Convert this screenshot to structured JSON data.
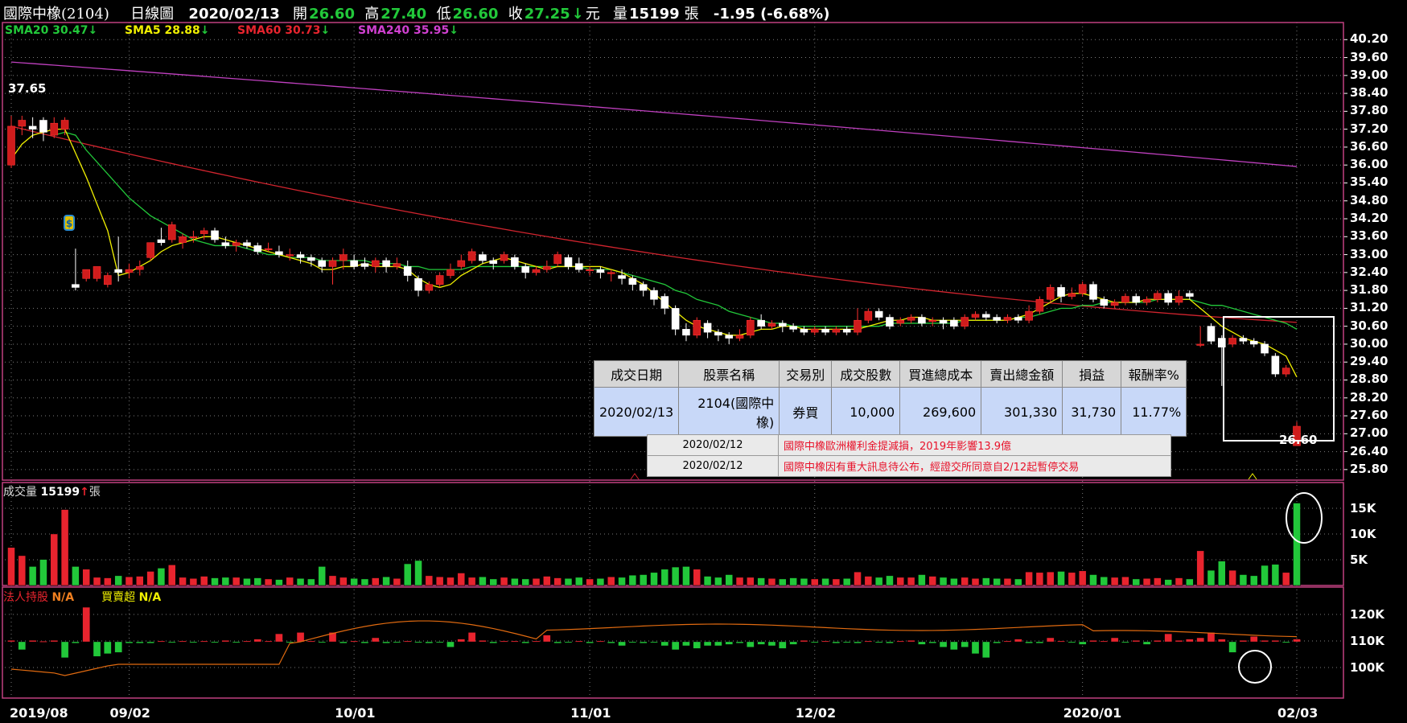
{
  "header": {
    "stock": "國際中橡(2104)",
    "period": "日線圖",
    "date": "2020/02/13",
    "open_label": "開",
    "open": "26.60",
    "high_label": "高",
    "high": "27.40",
    "low_label": "低",
    "low": "26.60",
    "close_label": "收",
    "close": "27.25",
    "currency": "元",
    "volume_label": "量",
    "volume": "15199",
    "volume_unit": "張",
    "change": "-1.95 (-6.68%)"
  },
  "sma": [
    {
      "label": "SMA20",
      "value": "30.47",
      "color": "#22c83a",
      "arrow": "down"
    },
    {
      "label": "SMA5",
      "value": "28.88",
      "color": "#f0f000",
      "arrow": "down"
    },
    {
      "label": "SMA60",
      "value": "30.73",
      "color": "#e8242e",
      "arrow": "down"
    },
    {
      "label": "SMA240",
      "value": "35.95",
      "color": "#d040d0",
      "arrow": "down"
    }
  ],
  "volume_panel": {
    "label": "成交量",
    "value": "15199",
    "unit": "張",
    "arrow": "up",
    "yticks": [
      "15K",
      "10K",
      "5K"
    ]
  },
  "inst_panel": {
    "label1": "法人持股",
    "value1": "N/A",
    "label2": "買賣超",
    "value2": "N/A",
    "yticks": [
      "120K",
      "110K",
      "100K"
    ]
  },
  "annotations": {
    "high_label": "37.65",
    "low_label": "26.60",
    "dividend_marker": "$"
  },
  "trade_table": {
    "headers": [
      "成交日期",
      "股票名稱",
      "交易別",
      "成交股數",
      "買進總成本",
      "賣出總金額",
      "損益",
      "報酬率%"
    ],
    "row": [
      "2020/02/13",
      "2104(國際中橡)",
      "券買",
      "10,000",
      "269,600",
      "301,330",
      "31,730",
      "11.77%"
    ]
  },
  "news": [
    {
      "date": "2020/02/12",
      "text": "國際中橡歐洲權利金提減損，2019年影響13.9億"
    },
    {
      "date": "2020/02/12",
      "text": "國際中橡因有重大訊息待公布，經證交所同意自2/12起暫停交易"
    }
  ],
  "chart_data": {
    "type": "candlestick",
    "title": "國際中橡(2104) 日線圖",
    "ylim": [
      25.5,
      40.45
    ],
    "price_ticks": [
      "40.20",
      "39.60",
      "39.00",
      "38.40",
      "37.80",
      "37.20",
      "36.60",
      "36.00",
      "35.40",
      "34.80",
      "34.20",
      "33.60",
      "33.00",
      "32.40",
      "31.80",
      "31.20",
      "30.60",
      "30.00",
      "29.40",
      "28.80",
      "28.20",
      "27.60",
      "27.00",
      "26.40",
      "25.80"
    ],
    "x_ticks": [
      "2019/08",
      "09/02",
      "10/01",
      "11/01",
      "12/02",
      "2020/01",
      "02/03"
    ],
    "candles": [
      [
        36.0,
        37.3,
        37.65,
        35.9,
        7000
      ],
      [
        37.3,
        37.5,
        37.65,
        37.0,
        5500
      ],
      [
        37.3,
        37.2,
        37.6,
        36.9,
        3500
      ],
      [
        37.5,
        37.1,
        37.6,
        36.8,
        4800
      ],
      [
        37.0,
        37.4,
        37.6,
        36.9,
        9500
      ],
      [
        37.2,
        37.5,
        37.6,
        37.0,
        14000
      ],
      [
        32.0,
        31.9,
        33.2,
        31.8,
        3500
      ],
      [
        32.2,
        32.5,
        32.5,
        32.1,
        3000
      ],
      [
        32.2,
        32.6,
        32.6,
        32.1,
        1500
      ],
      [
        32.0,
        32.3,
        32.4,
        31.9,
        1400
      ],
      [
        32.5,
        32.4,
        33.6,
        32.1,
        1800
      ],
      [
        32.4,
        32.5,
        32.7,
        32.2,
        1600
      ],
      [
        32.5,
        32.6,
        32.8,
        32.3,
        1700
      ],
      [
        32.9,
        33.4,
        33.4,
        32.8,
        2600
      ],
      [
        33.5,
        33.4,
        33.9,
        33.3,
        3200
      ],
      [
        33.5,
        34.0,
        34.1,
        33.4,
        3800
      ],
      [
        33.4,
        33.6,
        33.7,
        33.2,
        1500
      ],
      [
        33.6,
        33.6,
        33.8,
        33.4,
        1300
      ],
      [
        33.7,
        33.8,
        33.9,
        33.5,
        1700
      ],
      [
        33.8,
        33.5,
        33.9,
        33.4,
        1400
      ],
      [
        33.4,
        33.3,
        33.6,
        33.2,
        1500
      ],
      [
        33.3,
        33.4,
        33.5,
        33.1,
        1500
      ],
      [
        33.4,
        33.3,
        33.5,
        33.2,
        1300
      ],
      [
        33.3,
        33.1,
        33.4,
        33.0,
        1400
      ],
      [
        33.2,
        33.2,
        33.4,
        33.1,
        1200
      ],
      [
        33.1,
        33.0,
        33.3,
        32.9,
        1100
      ],
      [
        33.0,
        33.0,
        33.2,
        32.8,
        1500
      ],
      [
        33.0,
        32.9,
        33.1,
        32.7,
        1300
      ],
      [
        32.9,
        32.8,
        33.0,
        32.6,
        1200
      ],
      [
        32.8,
        32.6,
        32.9,
        32.4,
        3500
      ],
      [
        32.6,
        32.8,
        32.9,
        32.0,
        1800
      ],
      [
        32.8,
        33.0,
        33.2,
        32.5,
        1500
      ],
      [
        32.8,
        32.6,
        33.0,
        32.5,
        1300
      ],
      [
        32.7,
        32.6,
        32.9,
        32.5,
        1200
      ],
      [
        32.6,
        32.8,
        32.9,
        32.4,
        1400
      ],
      [
        32.8,
        32.6,
        32.9,
        32.4,
        1600
      ],
      [
        32.6,
        32.7,
        32.9,
        32.5,
        1300
      ],
      [
        32.6,
        32.3,
        32.8,
        32.1,
        4000
      ],
      [
        32.2,
        31.8,
        32.3,
        31.6,
        4600
      ],
      [
        31.8,
        32.0,
        32.1,
        31.7,
        1800
      ],
      [
        32.0,
        32.3,
        32.4,
        31.9,
        1600
      ],
      [
        32.3,
        32.5,
        32.7,
        32.2,
        1500
      ],
      [
        32.6,
        32.8,
        33.0,
        32.5,
        2300
      ],
      [
        32.8,
        33.1,
        33.2,
        32.7,
        1500
      ],
      [
        33.0,
        32.8,
        33.1,
        32.7,
        1600
      ],
      [
        32.8,
        32.7,
        32.9,
        32.5,
        1200
      ],
      [
        32.8,
        33.0,
        33.1,
        32.7,
        1500
      ],
      [
        32.9,
        32.6,
        33.0,
        32.5,
        1300
      ],
      [
        32.6,
        32.4,
        32.7,
        32.2,
        1200
      ],
      [
        32.4,
        32.5,
        32.6,
        32.3,
        1300
      ],
      [
        32.5,
        32.6,
        32.8,
        32.4,
        1700
      ],
      [
        32.7,
        33.0,
        33.1,
        32.6,
        1400
      ],
      [
        32.9,
        32.6,
        33.0,
        32.5,
        1300
      ],
      [
        32.7,
        32.5,
        32.9,
        32.4,
        1500
      ],
      [
        32.5,
        32.5,
        32.6,
        32.3,
        1200
      ],
      [
        32.5,
        32.4,
        32.6,
        32.2,
        1300
      ],
      [
        32.4,
        32.4,
        32.5,
        32.1,
        1600
      ],
      [
        32.3,
        32.2,
        32.5,
        32.0,
        1500
      ],
      [
        32.2,
        32.0,
        32.3,
        31.8,
        1900
      ],
      [
        32.0,
        31.8,
        32.1,
        31.6,
        2000
      ],
      [
        31.8,
        31.5,
        31.9,
        31.3,
        2400
      ],
      [
        31.6,
        31.2,
        31.7,
        31.0,
        3000
      ],
      [
        31.2,
        30.5,
        31.3,
        30.3,
        3400
      ],
      [
        30.5,
        30.3,
        30.7,
        30.1,
        3500
      ],
      [
        30.3,
        30.8,
        30.9,
        30.2,
        3000
      ],
      [
        30.7,
        30.4,
        30.8,
        30.2,
        1700
      ],
      [
        30.4,
        30.3,
        30.5,
        30.1,
        1500
      ],
      [
        30.3,
        30.2,
        30.4,
        30.0,
        2000
      ],
      [
        30.2,
        30.3,
        30.5,
        30.1,
        1500
      ],
      [
        30.3,
        30.8,
        30.9,
        30.2,
        1500
      ],
      [
        30.8,
        30.6,
        31.0,
        30.5,
        1400
      ],
      [
        30.6,
        30.7,
        30.8,
        30.5,
        1300
      ],
      [
        30.7,
        30.6,
        30.8,
        30.4,
        1200
      ],
      [
        30.6,
        30.5,
        30.7,
        30.4,
        1400
      ],
      [
        30.5,
        30.4,
        30.6,
        30.3,
        1300
      ],
      [
        30.4,
        30.5,
        30.6,
        30.3,
        1200
      ],
      [
        30.5,
        30.4,
        30.6,
        30.3,
        1300
      ],
      [
        30.4,
        30.5,
        30.6,
        30.3,
        1200
      ],
      [
        30.5,
        30.4,
        30.6,
        30.3,
        1300
      ],
      [
        30.4,
        30.8,
        31.2,
        30.3,
        2500
      ],
      [
        30.8,
        31.1,
        31.2,
        30.7,
        1700
      ],
      [
        31.1,
        30.9,
        31.2,
        30.8,
        1500
      ],
      [
        30.9,
        30.6,
        31.0,
        30.5,
        1800
      ],
      [
        30.7,
        30.8,
        30.9,
        30.6,
        1500
      ],
      [
        30.8,
        30.9,
        31.0,
        30.7,
        1500
      ],
      [
        30.9,
        30.7,
        31.0,
        30.6,
        2000
      ],
      [
        30.8,
        30.8,
        30.9,
        30.6,
        1700
      ],
      [
        30.8,
        30.7,
        30.9,
        30.5,
        1500
      ],
      [
        30.8,
        30.6,
        30.9,
        30.5,
        1300
      ],
      [
        30.6,
        30.9,
        31.0,
        30.5,
        1500
      ],
      [
        30.9,
        31.0,
        31.1,
        30.8,
        1300
      ],
      [
        31.0,
        30.9,
        31.1,
        30.8,
        1400
      ],
      [
        30.9,
        30.8,
        31.0,
        30.7,
        1300
      ],
      [
        30.8,
        30.9,
        31.0,
        30.7,
        1300
      ],
      [
        30.9,
        30.8,
        31.0,
        30.7,
        1200
      ],
      [
        30.8,
        31.1,
        31.3,
        30.7,
        2500
      ],
      [
        31.1,
        31.5,
        31.6,
        31.0,
        2400
      ],
      [
        31.5,
        31.9,
        32.0,
        31.4,
        2500
      ],
      [
        31.9,
        31.6,
        32.0,
        31.4,
        2600
      ],
      [
        31.6,
        31.7,
        31.9,
        31.5,
        2400
      ],
      [
        31.7,
        32.0,
        32.1,
        31.6,
        2700
      ],
      [
        32.0,
        31.5,
        32.1,
        31.4,
        2000
      ],
      [
        31.5,
        31.3,
        31.6,
        31.2,
        1600
      ],
      [
        31.3,
        31.4,
        31.5,
        31.2,
        1500
      ],
      [
        31.4,
        31.6,
        31.7,
        31.3,
        1600
      ],
      [
        31.6,
        31.4,
        31.7,
        31.3,
        1200
      ],
      [
        31.4,
        31.5,
        31.6,
        31.3,
        1300
      ],
      [
        31.5,
        31.7,
        31.8,
        31.4,
        1400
      ],
      [
        31.7,
        31.4,
        31.8,
        31.3,
        1100
      ],
      [
        31.4,
        31.6,
        31.8,
        31.3,
        1400
      ],
      [
        31.7,
        31.6,
        31.8,
        31.5,
        1200
      ],
      [
        30.0,
        30.0,
        30.6,
        29.9,
        6400
      ],
      [
        30.6,
        30.1,
        30.7,
        30.0,
        2800
      ],
      [
        30.2,
        29.9,
        30.3,
        28.6,
        4500
      ],
      [
        30.0,
        30.2,
        30.3,
        29.9,
        2800
      ],
      [
        30.2,
        30.1,
        30.3,
        30.0,
        2000
      ],
      [
        30.1,
        30.0,
        30.2,
        29.9,
        1800
      ],
      [
        30.0,
        29.7,
        30.1,
        29.6,
        3700
      ],
      [
        29.6,
        29.0,
        29.7,
        28.9,
        3900
      ],
      [
        29.0,
        29.2,
        29.3,
        28.9,
        2400
      ],
      [
        26.6,
        27.25,
        27.4,
        26.6,
        15199
      ]
    ],
    "sma5": [
      36.2,
      36.7,
      37.0,
      37.1,
      37.2,
      37.2,
      36.4,
      35.6,
      34.7,
      33.8,
      32.3,
      32.4,
      32.6,
      32.8,
      33.1,
      33.3,
      33.4,
      33.5,
      33.6,
      33.6,
      33.5,
      33.4,
      33.3,
      33.2,
      33.1,
      33.0,
      32.9,
      32.8,
      32.7,
      32.5,
      32.5,
      32.6,
      32.6,
      32.7,
      32.6,
      32.6,
      32.6,
      32.5,
      32.2,
      32.0,
      31.9,
      32.0,
      32.3,
      32.5,
      32.7,
      32.8,
      32.9,
      32.8,
      32.7,
      32.6,
      32.5,
      32.6,
      32.6,
      32.6,
      32.6,
      32.6,
      32.5,
      32.4,
      32.2,
      32.0,
      31.7,
      31.4,
      31.1,
      30.8,
      30.6,
      30.5,
      30.4,
      30.3,
      30.3,
      30.4,
      30.5,
      30.5,
      30.6,
      30.6,
      30.5,
      30.5,
      30.5,
      30.5,
      30.5,
      30.5,
      30.6,
      30.7,
      30.8,
      30.8,
      30.9,
      30.9,
      30.8,
      30.8,
      30.8,
      30.8,
      30.8,
      30.8,
      30.8,
      30.8,
      30.9,
      31.0,
      31.2,
      31.4,
      31.6,
      31.7,
      31.7,
      31.6,
      31.5,
      31.4,
      31.4,
      31.4,
      31.5,
      31.5,
      31.5,
      31.5,
      31.5,
      31.2,
      30.9,
      30.6,
      30.4,
      30.2,
      30.1,
      30.0,
      29.8,
      29.6,
      28.9
    ],
    "sma20": [
      null,
      null,
      null,
      null,
      37.0,
      37.1,
      37.0,
      36.5,
      36.1,
      35.7,
      35.3,
      34.9,
      34.6,
      34.3,
      34.1,
      33.9,
      33.7,
      33.5,
      33.4,
      33.3,
      33.3,
      33.3,
      33.2,
      33.1,
      33.0,
      33.0,
      32.9,
      32.9,
      32.9,
      32.8,
      32.8,
      32.8,
      32.8,
      32.8,
      32.7,
      32.7,
      32.7,
      32.6,
      32.6,
      32.5,
      32.5,
      32.5,
      32.5,
      32.6,
      32.6,
      32.6,
      32.6,
      32.6,
      32.6,
      32.6,
      32.6,
      32.6,
      32.6,
      32.6,
      32.5,
      32.5,
      32.5,
      32.4,
      32.3,
      32.2,
      32.1,
      32.0,
      31.8,
      31.7,
      31.5,
      31.4,
      31.3,
      31.1,
      31.0,
      30.9,
      30.8,
      30.7,
      30.7,
      30.6,
      30.6,
      30.6,
      30.6,
      30.6,
      30.6,
      30.6,
      30.6,
      30.6,
      30.7,
      30.7,
      30.7,
      30.7,
      30.7,
      30.7,
      30.7,
      30.8,
      30.8,
      30.8,
      30.8,
      30.8,
      30.9,
      30.9,
      31.0,
      31.1,
      31.2,
      31.2,
      31.3,
      31.3,
      31.4,
      31.4,
      31.4,
      31.4,
      31.4,
      31.5,
      31.5,
      31.5,
      31.5,
      31.4,
      31.3,
      31.3,
      31.2,
      31.1,
      31.0,
      30.9,
      30.8,
      30.7,
      30.5
    ],
    "sma60_start": 37.3,
    "sma60_end": 30.73,
    "sma240_start": 39.45,
    "sma240_end": 35.95,
    "volume_ylim": [
      0,
      17500
    ],
    "inst_net": [
      500,
      -3000,
      500,
      200,
      500,
      -6000,
      -500,
      13000,
      -5500,
      -4500,
      -4000,
      -500,
      -500,
      -500,
      300,
      -300,
      300,
      -300,
      300,
      -300,
      500,
      -300,
      300,
      1000,
      300,
      3000,
      -300,
      3500,
      300,
      -300,
      3500,
      -500,
      300,
      -500,
      1500,
      -500,
      -300,
      300,
      -300,
      -500,
      -300,
      -2000,
      1000,
      3500,
      500,
      -500,
      300,
      300,
      -500,
      300,
      2500,
      -500,
      -300,
      300,
      -500,
      300,
      -500,
      -1500,
      -300,
      -500,
      -300,
      -1500,
      -3000,
      -1500,
      -2500,
      -1500,
      -1500,
      -1000,
      -500,
      -2000,
      -1000,
      -1500,
      -2500,
      -1000,
      500,
      -300,
      300,
      -500,
      -300,
      -500,
      300,
      -300,
      -500,
      300,
      500,
      -1000,
      -500,
      -2000,
      -3000,
      -2000,
      -4500,
      -6000,
      -500,
      300,
      1000,
      -500,
      -500,
      1500,
      300,
      -300,
      -1000,
      500,
      300,
      1500,
      -300,
      500,
      -1000,
      500,
      3000,
      500,
      1000,
      1500,
      3500,
      1000,
      -4000,
      500,
      2000,
      500,
      500,
      -300,
      1000,
      2000,
      2000,
      -300,
      500,
      -300,
      300,
      1000,
      300,
      500,
      -300,
      1000,
      -500,
      -300,
      -9000,
      -3500,
      -2500,
      -1500
    ]
  }
}
